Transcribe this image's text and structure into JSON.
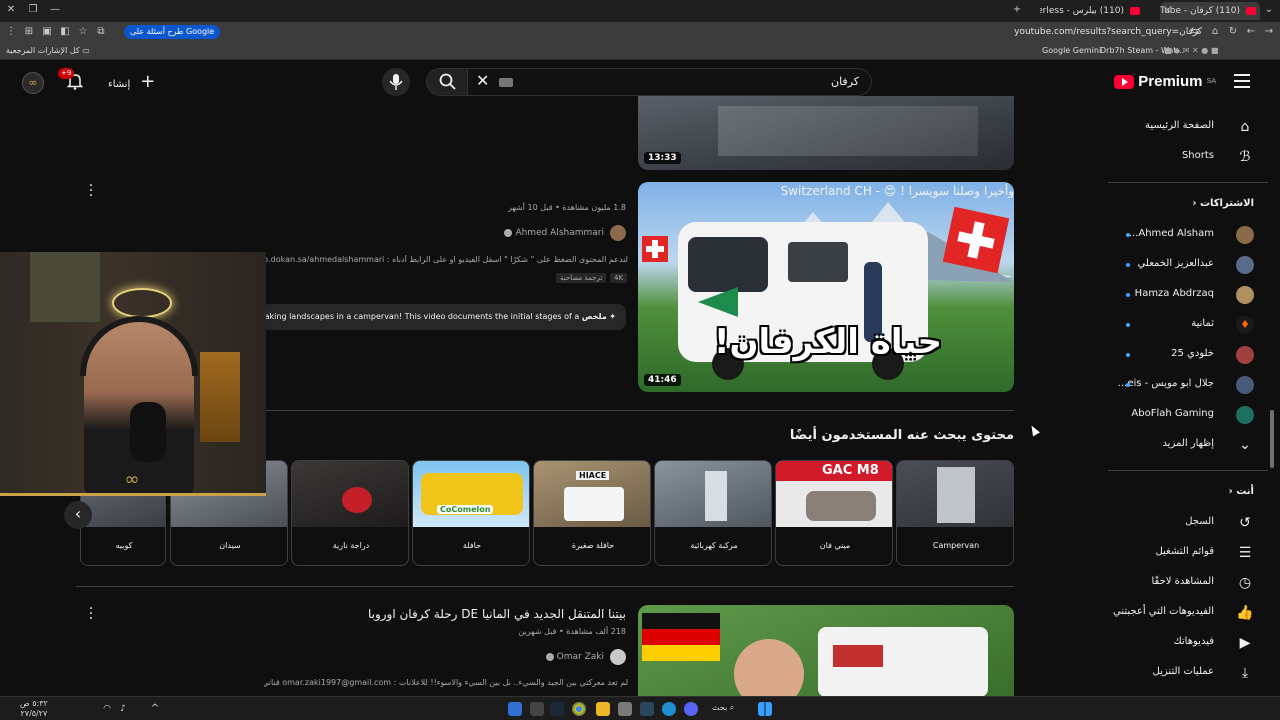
{
  "browser": {
    "tabs": [
      {
        "title": "(110) كرفان - YouTube",
        "active": true
      },
      {
        "title": "(110) بيلرس - YouTube - erless",
        "active": false
      }
    ],
    "url": "youtube.com/results?search_query=كرفان",
    "google_button": "طرح أسئلة على Google",
    "bookmarks": {
      "left_folder": "كل الإشارات المرجعية",
      "items": [
        "Google Gemini",
        "Drb7h Steam - Wat..."
      ]
    }
  },
  "header": {
    "logo_text": "Premium",
    "logo_region": "SA",
    "search_value": "كرفان",
    "create_label": "إنشاء",
    "notification_count": "+9"
  },
  "sidebar": {
    "top_items": [
      {
        "label": "الصفحة الرئيسية",
        "icon": "home-icon"
      },
      {
        "label": "Shorts",
        "icon": "shorts-icon"
      }
    ],
    "subscriptions_header": "الاشتراكات",
    "subscriptions": [
      {
        "label": "Ahmed Alsham...",
        "color": "#8a6a4a"
      },
      {
        "label": "عبدالعزيز الخمعلي",
        "color": "#5a6a8a"
      },
      {
        "label": "Hamza Abdrzaq",
        "color": "#b09060"
      },
      {
        "label": "ثمانية",
        "color": "#1a1a1a"
      },
      {
        "label": "خلودي 25",
        "color": "#a04040"
      },
      {
        "label": "جلال ابو مويس - eis...",
        "color": "#4a5a7a"
      },
      {
        "label": "AboFlah Gaming",
        "color": "#1f6f5f"
      }
    ],
    "show_more": "إظهار المزيد",
    "you_header": "أنت",
    "you_items": [
      {
        "label": "السجل",
        "icon": "history-icon"
      },
      {
        "label": "قوائم التشغيل",
        "icon": "playlists-icon"
      },
      {
        "label": "المشاهدة لاحقًا",
        "icon": "watch-later-icon"
      },
      {
        "label": "الفيديوهات التي أعجبتني",
        "icon": "like-icon"
      },
      {
        "label": "فيديوهاتك",
        "icon": "your-videos-icon"
      },
      {
        "label": "عمليات التنزيل",
        "icon": "download-icon"
      }
    ]
  },
  "videos": [
    {
      "duration": "13:33"
    },
    {
      "title": "وأخيرا وصلنا سويسرا ! 😍 - Switzerland CH",
      "meta": "1.8 مليون مشاهدة • قبل 10 أشهر",
      "channel": "Ahmed Alshammari",
      "description": "لندعم المحتوى الضغط على \" شكرًا \" اسفل الفيديو او على الرابط أدناه : https://tip.dokan.sa/ahmedalshammari",
      "chips": [
        "4K",
        "ترجمة مصاحبة"
      ],
      "summary_label": "ملخص",
      "summary_text": "aking landscapes in a campervan! This video documents the initial stages of a",
      "duration": "41:46",
      "thumb_text": "حياة الكرفان!"
    },
    {
      "title": "بيتنا المتنقل الجديد في المانيا DE رحلة كرفان اوروبا",
      "meta": "218 ألف مشاهدة • قبل شهرين",
      "channel": "Omar Zaki",
      "description": "لم تعد معركتي بين الجيد والسيء.. بل بين السيء والاسوء!! للاعلانات : omar.zaki1997@gmail.com قناتي الثانية ..."
    }
  ],
  "people_also_search": {
    "heading": "محتوى يبحث عنه المستخدمون أيضًا",
    "cards": [
      {
        "label": "Campervan",
        "color": "#3a3d42"
      },
      {
        "label": "ميني فان",
        "color": "#c9c9c9",
        "img_text": "GAC M8"
      },
      {
        "label": "مركبة كهربائية",
        "color": "#6a7580"
      },
      {
        "label": "حافلة صغيرة",
        "color": "#8a7a60",
        "img_text": "HIACE"
      },
      {
        "label": "حافلة",
        "color": "#e8c020",
        "img_text": "CoComelon"
      },
      {
        "label": "دراجة نارية",
        "color": "#5a4a4a"
      },
      {
        "label": "سيدان",
        "color": "#7a7f85"
      },
      {
        "label": "كوبيه",
        "color": "#5a5f66"
      }
    ]
  },
  "taskbar": {
    "search_label": "بحث",
    "time": "٥:٣٢ ص",
    "date": "٢٧/٥/٢٧"
  }
}
